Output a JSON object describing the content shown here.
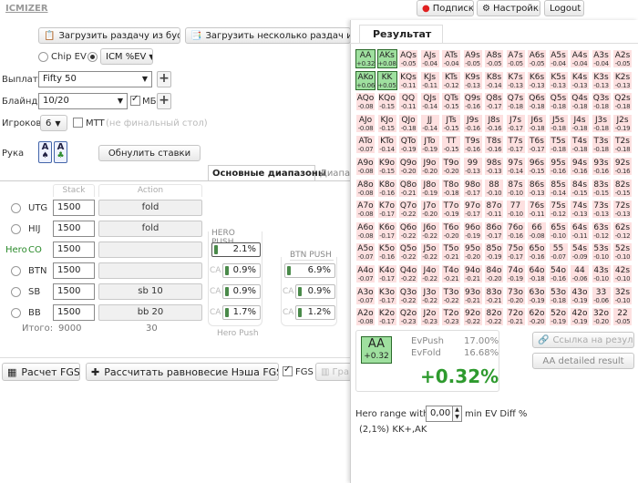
{
  "app": {
    "logo": "ICMIZER"
  },
  "header": {
    "subscription": "Подписка",
    "settings": "Настройки",
    "logout": "Logout"
  },
  "toolbar": {
    "load_clipboard": "Загрузить раздачу из буфера",
    "load_multiple": "Загрузить несколько раздач или тур"
  },
  "mode": {
    "chip_ev": "Chip EV",
    "icm_ev": "ICM %EV"
  },
  "form": {
    "payouts_label": "Выплаты",
    "payouts_value": "Fifty 50",
    "blinds_label": "Блайнды",
    "blinds_value": "10/20",
    "mb_label": "МБ",
    "players_label": "Игроков",
    "players_value": "6",
    "mtt_label": "MTT",
    "mtt_hint": "(не финальный стол)",
    "hand_label": "Рука",
    "hand_card1": "A",
    "hand_card2": "A",
    "reset_bets": "Обнулить ставки"
  },
  "tabs": {
    "main_ranges": "Основные диапазоны",
    "ranges2": "Диапаз"
  },
  "table": {
    "col_stack": "Stack",
    "col_action": "Action",
    "col_hero_push": "HERO PUSH",
    "col_btn_push": "BTN PUSH",
    "hero_push_footer": "Hero Push",
    "ca": "CA",
    "hero_marker": "Hero",
    "rows": [
      {
        "pos": "UTG",
        "stack": "1500",
        "action": "fold",
        "hero_push": "",
        "btn_push": ""
      },
      {
        "pos": "HIJ",
        "stack": "1500",
        "action": "fold",
        "hero_push": "",
        "btn_push": ""
      },
      {
        "pos": "CO",
        "stack": "1500",
        "action": "",
        "hero_push": "2.1%",
        "btn_push": ""
      },
      {
        "pos": "BTN",
        "stack": "1500",
        "action": "",
        "hero_push": "0.9%",
        "btn_push": "6.9%"
      },
      {
        "pos": "SB",
        "stack": "1500",
        "action": "sb 10",
        "hero_push": "0.9%",
        "btn_push": "0.9%"
      },
      {
        "pos": "BB",
        "stack": "1500",
        "action": "bb 20",
        "hero_push": "1.7%",
        "btn_push": "1.2%"
      }
    ],
    "total_label": "Итого:",
    "total_stack": "9000",
    "total_action": "30"
  },
  "bottom": {
    "calc_fgs": "Расчет FGS",
    "nash": "Рассчитать равновесие Нэша FGS",
    "fgs_label": "FGS",
    "graph": "Гра"
  },
  "result": {
    "title": "Результат",
    "grid": [
      [
        [
          "AA",
          "+0.32"
        ],
        [
          "AKs",
          "+0.08"
        ],
        [
          "AQs",
          "-0.05"
        ],
        [
          "AJs",
          "-0.04"
        ],
        [
          "ATs",
          "-0.04"
        ],
        [
          "A9s",
          "-0.05"
        ],
        [
          "A8s",
          "-0.05"
        ],
        [
          "A7s",
          "-0.05"
        ],
        [
          "A6s",
          "-0.05"
        ],
        [
          "A5s",
          "-0.04"
        ],
        [
          "A4s",
          "-0.04"
        ],
        [
          "A3s",
          "-0.04"
        ],
        [
          "A2s",
          "-0.05"
        ]
      ],
      [
        [
          "AKo",
          "+0.06"
        ],
        [
          "KK",
          "+0.05"
        ],
        [
          "KQs",
          "-0.11"
        ],
        [
          "KJs",
          "-0.11"
        ],
        [
          "KTs",
          "-0.12"
        ],
        [
          "K9s",
          "-0.13"
        ],
        [
          "K8s",
          "-0.14"
        ],
        [
          "K7s",
          "-0.13"
        ],
        [
          "K6s",
          "-0.13"
        ],
        [
          "K5s",
          "-0.13"
        ],
        [
          "K4s",
          "-0.13"
        ],
        [
          "K3s",
          "-0.13"
        ],
        [
          "K2s",
          "-0.13"
        ]
      ],
      [
        [
          "AQo",
          "-0.08"
        ],
        [
          "KQo",
          "-0.15"
        ],
        [
          "QQ",
          "-0.11"
        ],
        [
          "QJs",
          "-0.14"
        ],
        [
          "QTs",
          "-0.15"
        ],
        [
          "Q9s",
          "-0.16"
        ],
        [
          "Q8s",
          "-0.17"
        ],
        [
          "Q7s",
          "-0.18"
        ],
        [
          "Q6s",
          "-0.18"
        ],
        [
          "Q5s",
          "-0.18"
        ],
        [
          "Q4s",
          "-0.18"
        ],
        [
          "Q3s",
          "-0.18"
        ],
        [
          "Q2s",
          "-0.18"
        ]
      ],
      [
        [
          "AJo",
          "-0.08"
        ],
        [
          "KJo",
          "-0.15"
        ],
        [
          "QJo",
          "-0.18"
        ],
        [
          "JJ",
          "-0.14"
        ],
        [
          "JTs",
          "-0.15"
        ],
        [
          "J9s",
          "-0.16"
        ],
        [
          "J8s",
          "-0.16"
        ],
        [
          "J7s",
          "-0.17"
        ],
        [
          "J6s",
          "-0.18"
        ],
        [
          "J5s",
          "-0.18"
        ],
        [
          "J4s",
          "-0.18"
        ],
        [
          "J3s",
          "-0.18"
        ],
        [
          "J2s",
          "-0.19"
        ]
      ],
      [
        [
          "ATo",
          "-0.07"
        ],
        [
          "KTo",
          "-0.14"
        ],
        [
          "QTo",
          "-0.19"
        ],
        [
          "JTo",
          "-0.19"
        ],
        [
          "TT",
          "-0.15"
        ],
        [
          "T9s",
          "-0.16"
        ],
        [
          "T8s",
          "-0.16"
        ],
        [
          "T7s",
          "-0.17"
        ],
        [
          "T6s",
          "-0.17"
        ],
        [
          "T5s",
          "-0.18"
        ],
        [
          "T4s",
          "-0.18"
        ],
        [
          "T3s",
          "-0.18"
        ],
        [
          "T2s",
          "-0.18"
        ]
      ],
      [
        [
          "A9o",
          "-0.08"
        ],
        [
          "K9o",
          "-0.15"
        ],
        [
          "Q9o",
          "-0.20"
        ],
        [
          "J9o",
          "-0.20"
        ],
        [
          "T9o",
          "-0.20"
        ],
        [
          "99",
          "-0.13"
        ],
        [
          "98s",
          "-0.13"
        ],
        [
          "97s",
          "-0.14"
        ],
        [
          "96s",
          "-0.15"
        ],
        [
          "95s",
          "-0.16"
        ],
        [
          "94s",
          "-0.16"
        ],
        [
          "93s",
          "-0.16"
        ],
        [
          "92s",
          "-0.16"
        ]
      ],
      [
        [
          "A8o",
          "-0.08"
        ],
        [
          "K8o",
          "-0.16"
        ],
        [
          "Q8o",
          "-0.21"
        ],
        [
          "J8o",
          "-0.19"
        ],
        [
          "T8o",
          "-0.18"
        ],
        [
          "98o",
          "-0.17"
        ],
        [
          "88",
          "-0.10"
        ],
        [
          "87s",
          "-0.10"
        ],
        [
          "86s",
          "-0.13"
        ],
        [
          "85s",
          "-0.14"
        ],
        [
          "84s",
          "-0.15"
        ],
        [
          "83s",
          "-0.15"
        ],
        [
          "82s",
          "-0.15"
        ]
      ],
      [
        [
          "A7o",
          "-0.08"
        ],
        [
          "K7o",
          "-0.17"
        ],
        [
          "Q7o",
          "-0.22"
        ],
        [
          "J7o",
          "-0.20"
        ],
        [
          "T7o",
          "-0.19"
        ],
        [
          "97o",
          "-0.17"
        ],
        [
          "87o",
          "-0.11"
        ],
        [
          "77",
          "-0.10"
        ],
        [
          "76s",
          "-0.11"
        ],
        [
          "75s",
          "-0.12"
        ],
        [
          "74s",
          "-0.13"
        ],
        [
          "73s",
          "-0.13"
        ],
        [
          "72s",
          "-0.13"
        ]
      ],
      [
        [
          "A6o",
          "-0.08"
        ],
        [
          "K6o",
          "-0.17"
        ],
        [
          "Q6o",
          "-0.22"
        ],
        [
          "J6o",
          "-0.22"
        ],
        [
          "T6o",
          "-0.20"
        ],
        [
          "96o",
          "-0.19"
        ],
        [
          "86o",
          "-0.17"
        ],
        [
          "76o",
          "-0.16"
        ],
        [
          "66",
          "-0.08"
        ],
        [
          "65s",
          "-0.10"
        ],
        [
          "64s",
          "-0.11"
        ],
        [
          "63s",
          "-0.12"
        ],
        [
          "62s",
          "-0.12"
        ]
      ],
      [
        [
          "A5o",
          "-0.07"
        ],
        [
          "K5o",
          "-0.16"
        ],
        [
          "Q5o",
          "-0.22"
        ],
        [
          "J5o",
          "-0.22"
        ],
        [
          "T5o",
          "-0.21"
        ],
        [
          "95o",
          "-0.20"
        ],
        [
          "85o",
          "-0.19"
        ],
        [
          "75o",
          "-0.17"
        ],
        [
          "65o",
          "-0.16"
        ],
        [
          "55",
          "-0.07"
        ],
        [
          "54s",
          "-0.09"
        ],
        [
          "53s",
          "-0.10"
        ],
        [
          "52s",
          "-0.10"
        ]
      ],
      [
        [
          "A4o",
          "-0.07"
        ],
        [
          "K4o",
          "-0.17"
        ],
        [
          "Q4o",
          "-0.22"
        ],
        [
          "J4o",
          "-0.22"
        ],
        [
          "T4o",
          "-0.21"
        ],
        [
          "94o",
          "-0.21"
        ],
        [
          "84o",
          "-0.20"
        ],
        [
          "74o",
          "-0.19"
        ],
        [
          "64o",
          "-0.18"
        ],
        [
          "54o",
          "-0.16"
        ],
        [
          "44",
          "-0.06"
        ],
        [
          "43s",
          "-0.10"
        ],
        [
          "42s",
          "-0.10"
        ]
      ],
      [
        [
          "A3o",
          "-0.07"
        ],
        [
          "K3o",
          "-0.17"
        ],
        [
          "Q3o",
          "-0.22"
        ],
        [
          "J3o",
          "-0.22"
        ],
        [
          "T3o",
          "-0.22"
        ],
        [
          "93o",
          "-0.21"
        ],
        [
          "83o",
          "-0.21"
        ],
        [
          "73o",
          "-0.20"
        ],
        [
          "63o",
          "-0.19"
        ],
        [
          "53o",
          "-0.18"
        ],
        [
          "43o",
          "-0.19"
        ],
        [
          "33",
          "-0.06"
        ],
        [
          "32s",
          "-0.10"
        ]
      ],
      [
        [
          "A2o",
          "-0.08"
        ],
        [
          "K2o",
          "-0.17"
        ],
        [
          "Q2o",
          "-0.23"
        ],
        [
          "J2o",
          "-0.23"
        ],
        [
          "T2o",
          "-0.23"
        ],
        [
          "92o",
          "-0.22"
        ],
        [
          "82o",
          "-0.22"
        ],
        [
          "72o",
          "-0.21"
        ],
        [
          "62o",
          "-0.20"
        ],
        [
          "52o",
          "-0.19"
        ],
        [
          "42o",
          "-0.19"
        ],
        [
          "32o",
          "-0.20"
        ],
        [
          "22",
          "-0.05"
        ]
      ]
    ],
    "selected_hand": "AA",
    "selected_ev": "+0.32",
    "evpush_label": "EvPush",
    "evpush_value": "17.00%",
    "evfold_label": "EvFold",
    "evfold_value": "16.68%",
    "diff": "+0.32%",
    "link_button": "Ссылка на результат",
    "detailed_button": "AA detailed result",
    "hero_range_label": "Hero range with",
    "hero_range_value": "0,00",
    "hero_range_suffix": "min EV Diff %",
    "hero_range_summary": "(2,1%) KK+,AK"
  },
  "colors": {
    "positive": "#9fe09f",
    "negative": "#fde0e0",
    "accent_green": "#2e9a2e"
  }
}
